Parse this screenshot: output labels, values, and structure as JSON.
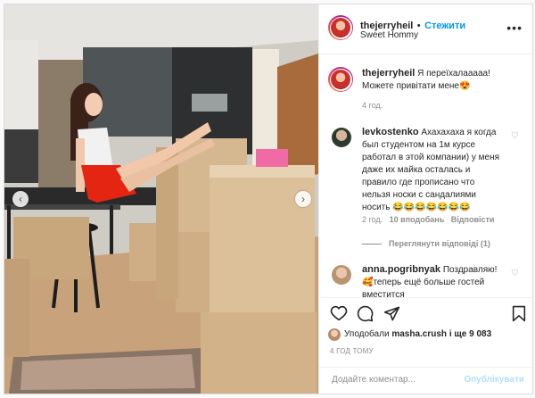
{
  "post": {
    "username": "thejerryheil",
    "follow_label": "Стежити",
    "location": "Sweet Hommy",
    "more_icon": "more-options-icon"
  },
  "caption": {
    "username": "thejerryheil",
    "text": "Я переїхалааааа! Можете привітати мене😍",
    "time": "4 год."
  },
  "comments": [
    {
      "username": "levkostenko",
      "text": "Ахахахаха я когда был студентом на 1м курсе работал в этой компании) у меня даже их майка осталась и правило где прописано что нельзя носки с сандалиями носить 😂😂😂😂😂😂😂",
      "time": "2 год.",
      "likes": "10 вподобань",
      "reply": "Відповісти",
      "view_replies": "Переглянути відповіді (1)"
    },
    {
      "username": "anna.pogribnyak",
      "text": "Поздравляю! 🥰теперь ещё больше гостей вместится"
    }
  ],
  "likes_row": {
    "prefix": "Уподобали",
    "user": "masha.crush",
    "suffix": "і ще 9 083"
  },
  "timestamp": "4 ГОД ТОМУ",
  "add_comment": {
    "placeholder": "Додайте коментар...",
    "publish_label": "Опублікувати"
  },
  "colors": {
    "accent": "#0095f6",
    "secondary_text": "#8e8e8e",
    "publish_disabled": "#b2dffc"
  }
}
